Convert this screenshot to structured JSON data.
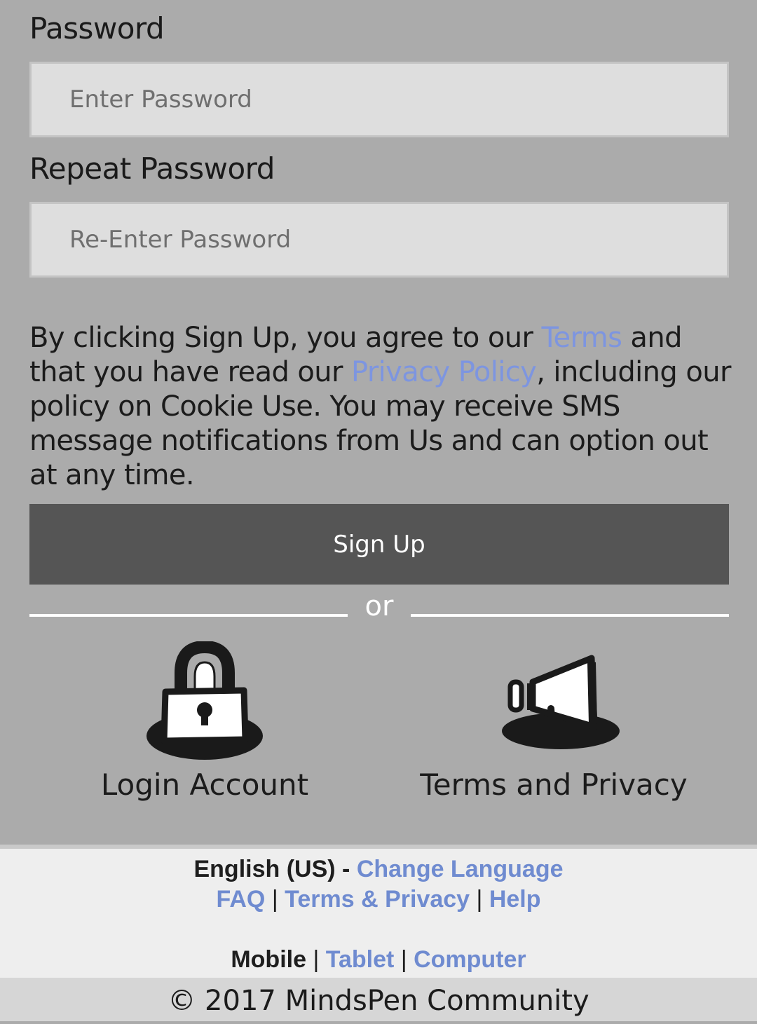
{
  "form": {
    "password_label": "Password",
    "password_placeholder": "Enter Password",
    "repeat_label": "Repeat Password",
    "repeat_placeholder": "Re-Enter Password"
  },
  "agreement": {
    "part1": "By clicking Sign Up, you agree to our ",
    "terms_link": "Terms",
    "part2": " and that you have read our ",
    "privacy_link": "Privacy Policy",
    "part3": ", including our policy on Cookie Use. You may receive SMS message notifications from Us and can option out at any time."
  },
  "signup": {
    "label": "Sign Up"
  },
  "divider": {
    "text": "or"
  },
  "actions": [
    {
      "label": "Login Account",
      "icon": "lock-icon"
    },
    {
      "label": "Terms and Privacy",
      "icon": "megaphone-icon"
    }
  ],
  "footer": {
    "language": "English (US)",
    "language_sep": " - ",
    "change_language": "Change Language",
    "faq": "FAQ",
    "terms_privacy": "Terms & Privacy",
    "help": "Help",
    "mobile": "Mobile",
    "tablet": "Tablet",
    "computer": "Computer",
    "pipe": "|"
  },
  "copyright": "© 2017 MindsPen Community",
  "colors": {
    "background": "#ababab",
    "link": "#7d95e0",
    "button": "#555555",
    "footer_link": "#6f8bd0"
  }
}
